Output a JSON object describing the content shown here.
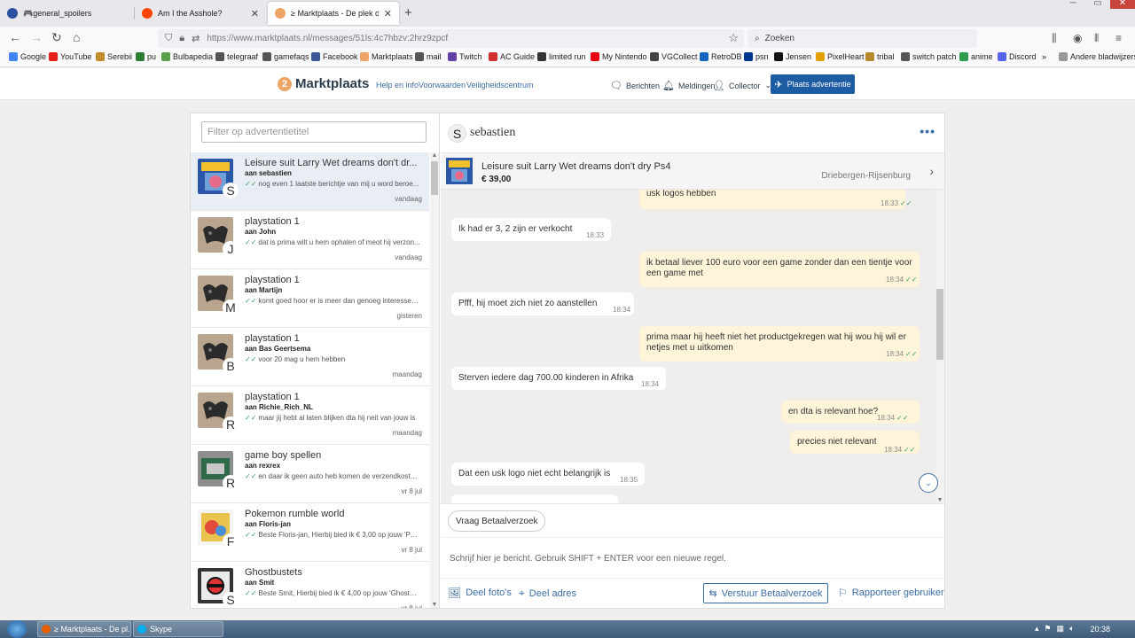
{
  "browser": {
    "tabs": [
      {
        "label": "🎮general_spoilers"
      },
      {
        "label": "Am I the Asshole?"
      },
      {
        "label": "≥ Marktplaats - De plek om nie"
      }
    ],
    "url": "https://www.marktplaats.nl/messages/51ls:4c7hbzv:2hrz9zpcf",
    "search_placeholder": "Zoeken",
    "bookmarks": [
      "Google",
      "YouTube",
      "Serebii",
      "pu",
      "Bulbapedia",
      "telegraaf",
      "gamefaqs",
      "Facebook",
      "Marktplaats",
      "mail",
      "Twitch",
      "AC Guide",
      "limited run",
      "My Nintendo",
      "VGCollect",
      "RetroDB",
      "psn",
      "Jensen",
      "PixelHeart",
      "tribal",
      "switch patch",
      "anime",
      "Discord",
      "Andere bladwijzers"
    ]
  },
  "header": {
    "logo_badge": "2",
    "logo_text": "Marktplaats",
    "links": [
      "Help en info",
      "Voorwaarden",
      "Veiligheidscentrum"
    ],
    "berichten": "Berichten",
    "meldingen": "Meldingen",
    "collector": "Collector",
    "place_ad": "Plaats advertentie"
  },
  "conversations": {
    "filter_placeholder": "Filter op advertentietitel",
    "items": [
      {
        "title": "Leisure suit Larry Wet dreams don't dr...",
        "user": "aan sebastien",
        "preview": "nog even 1 laatste berichtje van mij u word beroe...",
        "date": "vandaag",
        "letter": "S"
      },
      {
        "title": "playstation 1",
        "user": "aan John",
        "preview": "dat is prima wilt u hem ophalen of meot hij verzon...",
        "date": "vandaag",
        "letter": "J"
      },
      {
        "title": "playstation 1",
        "user": "aan Martijn",
        "preview": "komt goed hoor er is meer dan genoeg interesse v...",
        "date": "gisteren",
        "letter": "M"
      },
      {
        "title": "playstation 1",
        "user": "aan Bas Geertsema",
        "preview": "voor 20 mag u hem hebben",
        "date": "maandag",
        "letter": "B"
      },
      {
        "title": "playstation 1",
        "user": "aan Richie_Rich_NL",
        "preview": "maar jij hebt al laten blijken dta hij neit van jouw is",
        "date": "maandag",
        "letter": "R"
      },
      {
        "title": "game boy spellen",
        "user": "aan rexrex",
        "preview": "en daar ik geen auto heb komen de verzendkosten ...",
        "date": "vr 8 jul",
        "letter": "R"
      },
      {
        "title": "Pokemon rumble world",
        "user": "aan Floris-jan",
        "preview": "Beste Floris-jan, Hierbij bied ik € 3,00 op jouw 'Pok...",
        "date": "vr 8 jul",
        "letter": "F"
      },
      {
        "title": "Ghostbustets",
        "user": "aan Smit",
        "preview": "Beste Smit, Hierbij bied ik € 4,00 op jouw 'Ghostbu...",
        "date": "vr 8 jul",
        "letter": "S"
      }
    ]
  },
  "chat": {
    "avatar_letter": "S",
    "name": "sebastien",
    "more": "•••",
    "listing": {
      "title": "Leisure suit Larry Wet dreams don't dry Ps4",
      "price": "€ 39,00",
      "location": "Driebergen-Rijsenburg"
    },
    "messages": [
      {
        "dir": "out",
        "text": "usk logos hebben",
        "time": "18:33"
      },
      {
        "dir": "in",
        "text": "Ik had er 3, 2 zijn er verkocht",
        "time": "18:33"
      },
      {
        "dir": "out",
        "text": "ik betaal liever 100 euro voor een game zonder dan een tientje voor een game met",
        "time": "18:34"
      },
      {
        "dir": "in",
        "text": "Pfff, hij moet zich niet zo aanstellen",
        "time": "18:34"
      },
      {
        "dir": "out",
        "text": "prima maar hij heeft niet het productgekregen wat hij wou hij wil er netjes met u uitkomen",
        "time": "18:34"
      },
      {
        "dir": "in",
        "text": "Sterven iedere dag 700.00 kinderen in Afrika",
        "time": "18:34"
      },
      {
        "dir": "out",
        "text": "en dta is relevant hoe?",
        "time": "18:34"
      },
      {
        "dir": "out",
        "text": "precies niet relevant",
        "time": "18:34"
      },
      {
        "dir": "in",
        "text": "Dat een usk logo niet echt belangrijk is",
        "time": "18:35"
      }
    ],
    "quick_reply": "Vraag Betaalverzoek",
    "compose_placeholder": "Schrijf hier je bericht. Gebruik SHIFT + ENTER voor een nieuwe regel.",
    "actions": {
      "share_photos": "Deel foto's",
      "share_address": "Deel adres",
      "send_payment_request": "Verstuur Betaalverzoek",
      "report_user": "Rapporteer gebruiker"
    }
  },
  "taskbar": {
    "items": [
      "≥ Marktplaats - De pl...",
      "Skype"
    ],
    "clock": "20:38"
  },
  "colors": {
    "accent_blue": "#1d5ba3",
    "link_blue": "#3c6ea5",
    "outgoing_bubble": "#fdf4d9",
    "incoming_bubble": "#ffffff",
    "logo_orange": "#eda566",
    "check_green": "#3a9d5d"
  }
}
